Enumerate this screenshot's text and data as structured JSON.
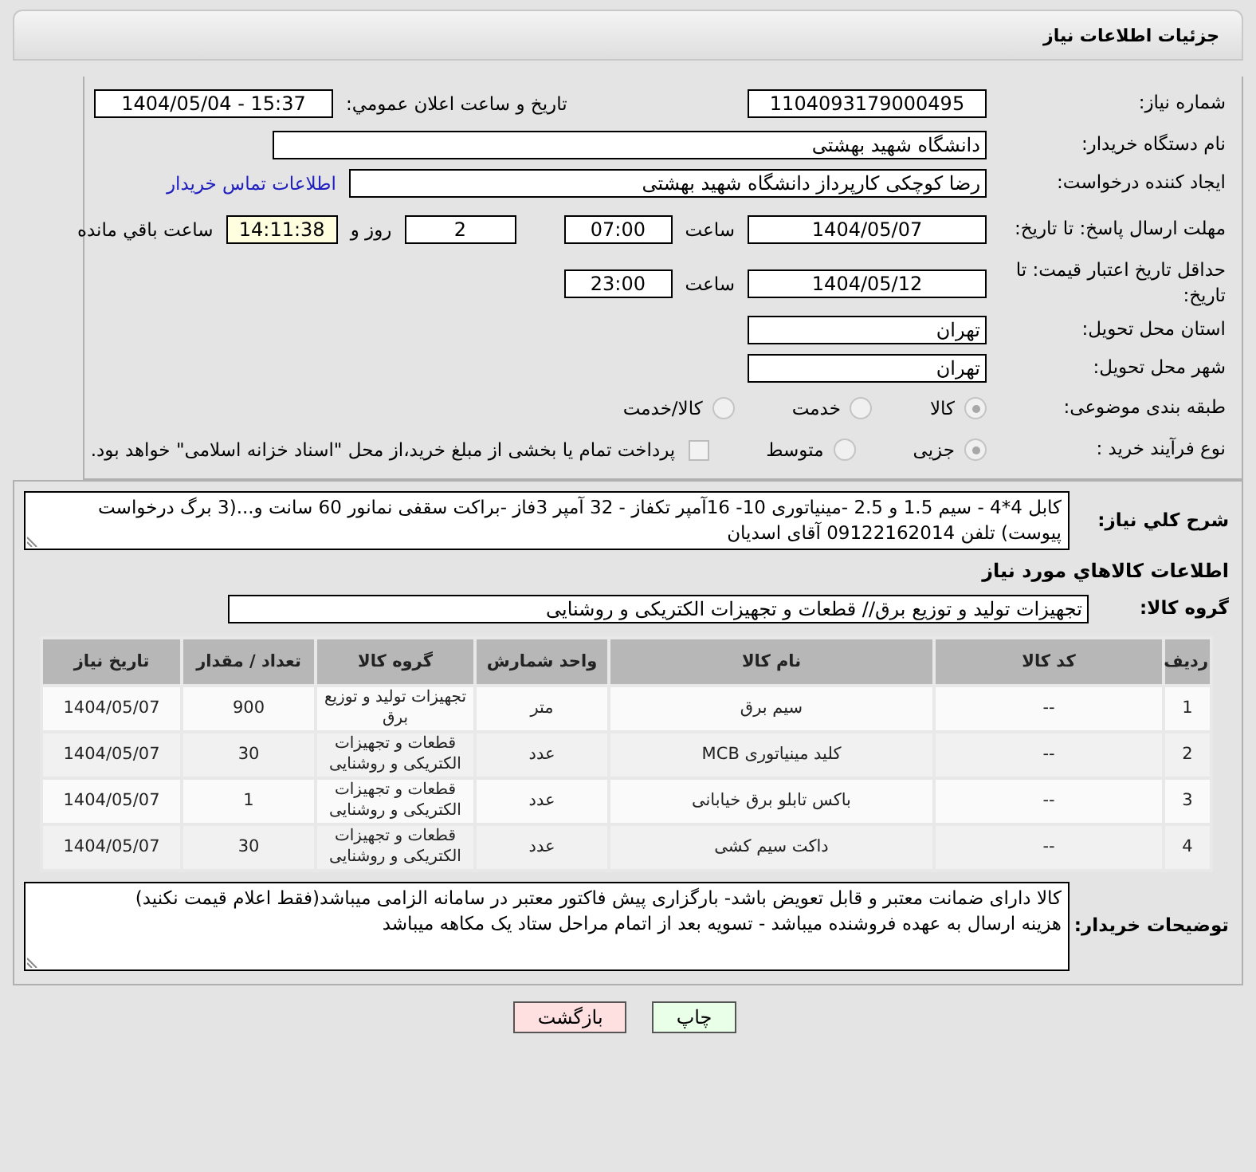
{
  "header": {
    "title": "جزئیات اطلاعات نیاز"
  },
  "need_number": {
    "label": "شماره نیاز:",
    "value": "1104093179000495"
  },
  "announce_datetime": {
    "label": "تاریخ و ساعت اعلان عمومي:",
    "value": "1404/05/04 - 15:37"
  },
  "buyer_org": {
    "label": "نام دستگاه خریدار:",
    "value": "دانشگاه شهید بهشتی"
  },
  "requester": {
    "label": "ایجاد کننده درخواست:",
    "value": "رضا کوچکی کارپرداز دانشگاه شهید بهشتی",
    "link": "اطلاعات تماس خریدار"
  },
  "response_deadline": {
    "label": "مهلت ارسال پاسخ: تا تاریخ:",
    "date": "1404/05/07",
    "time_label": "ساعت",
    "time": "07:00",
    "days": "2",
    "days_label": "روز و",
    "remaining": "14:11:38",
    "remaining_label": "ساعت باقي مانده"
  },
  "price_validity": {
    "label": "حداقل تاریخ اعتبار قیمت: تا تاریخ:",
    "date": "1404/05/12",
    "time_label": "ساعت",
    "time": "23:00"
  },
  "delivery_province": {
    "label": "استان محل تحویل:",
    "value": "تهران"
  },
  "delivery_city": {
    "label": "شهر محل تحویل:",
    "value": "تهران"
  },
  "subject_category": {
    "label": "طبقه بندی موضوعی:",
    "options": [
      {
        "label": "کالا",
        "selected": true
      },
      {
        "label": "خدمت",
        "selected": false
      },
      {
        "label": "کالا/خدمت",
        "selected": false
      }
    ]
  },
  "purchase_type": {
    "label": "نوع فرآیند خرید :",
    "options": [
      {
        "label": "جزیی",
        "selected": true
      },
      {
        "label": "متوسط",
        "selected": false
      }
    ],
    "treasury": {
      "label": "پرداخت تمام یا بخشی از مبلغ خرید،از محل \"اسناد خزانه اسلامی\" خواهد بود.",
      "checked": false
    }
  },
  "description": {
    "label": "شرح کلي نياز:",
    "value": "کابل 4*4 - سیم 1.5 و 2.5 -مینیاتوری 10- 16آمپر تکفاز - 32 آمپر 3فاز -براکت سقفی نمانور 60 سانت و...(3 برگ درخواست پیوست) تلفن 09122162014 آقای اسدیان"
  },
  "goods_heading": "اطلاعات کالاهاي مورد نياز",
  "goods_group": {
    "label": "گروه کالا:",
    "value": "تجهیزات تولید و توزیع برق// قطعات و تجهیزات الکتریکی و روشنایی"
  },
  "table": {
    "columns": [
      "ردیف",
      "کد کالا",
      "نام کالا",
      "واحد شمارش",
      "گروه کالا",
      "تعداد / مقدار",
      "تاریخ نیاز"
    ],
    "rows": [
      [
        "1",
        "--",
        "سیم برق",
        "متر",
        "تجهیزات تولید و توزیع برق",
        "900",
        "1404/05/07"
      ],
      [
        "2",
        "--",
        "کلید مینیاتوری MCB",
        "عدد",
        "قطعات و تجهیزات الکتریکی و روشنایی",
        "30",
        "1404/05/07"
      ],
      [
        "3",
        "--",
        "باکس تابلو برق خیابانی",
        "عدد",
        "قطعات و تجهیزات الکتریکی و روشنایی",
        "1",
        "1404/05/07"
      ],
      [
        "4",
        "--",
        "داکت سیم کشی",
        "عدد",
        "قطعات و تجهیزات الکتریکی و روشنایی",
        "30",
        "1404/05/07"
      ]
    ]
  },
  "buyer_notes": {
    "label": "توضیحات خریدار:",
    "lines": [
      "کالا دارای ضمانت معتبر و قابل تعویض باشد- بارگزاری پیش فاکتور معتبر در سامانه الزامی میباشد(فقط اعلام قیمت نکنید)",
      "هزینه ارسال به عهده فروشنده میباشد - تسویه بعد از اتمام مراحل ستاد یک مکاهه میباشد"
    ]
  },
  "buttons": [
    {
      "kind": "print",
      "label": "چاپ"
    },
    {
      "kind": "back",
      "label": "بازگشت"
    }
  ]
}
